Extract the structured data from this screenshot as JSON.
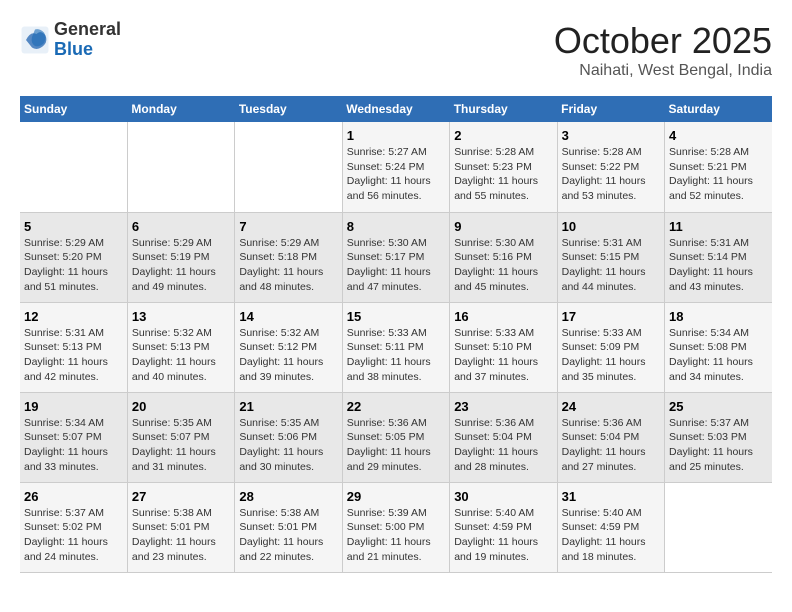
{
  "logo": {
    "general": "General",
    "blue": "Blue"
  },
  "title": "October 2025",
  "subtitle": "Naihati, West Bengal, India",
  "days_of_week": [
    "Sunday",
    "Monday",
    "Tuesday",
    "Wednesday",
    "Thursday",
    "Friday",
    "Saturday"
  ],
  "weeks": [
    [
      {
        "day": "",
        "sunrise": "",
        "sunset": "",
        "daylight": ""
      },
      {
        "day": "",
        "sunrise": "",
        "sunset": "",
        "daylight": ""
      },
      {
        "day": "",
        "sunrise": "",
        "sunset": "",
        "daylight": ""
      },
      {
        "day": "1",
        "sunrise": "Sunrise: 5:27 AM",
        "sunset": "Sunset: 5:24 PM",
        "daylight": "Daylight: 11 hours and 56 minutes."
      },
      {
        "day": "2",
        "sunrise": "Sunrise: 5:28 AM",
        "sunset": "Sunset: 5:23 PM",
        "daylight": "Daylight: 11 hours and 55 minutes."
      },
      {
        "day": "3",
        "sunrise": "Sunrise: 5:28 AM",
        "sunset": "Sunset: 5:22 PM",
        "daylight": "Daylight: 11 hours and 53 minutes."
      },
      {
        "day": "4",
        "sunrise": "Sunrise: 5:28 AM",
        "sunset": "Sunset: 5:21 PM",
        "daylight": "Daylight: 11 hours and 52 minutes."
      }
    ],
    [
      {
        "day": "5",
        "sunrise": "Sunrise: 5:29 AM",
        "sunset": "Sunset: 5:20 PM",
        "daylight": "Daylight: 11 hours and 51 minutes."
      },
      {
        "day": "6",
        "sunrise": "Sunrise: 5:29 AM",
        "sunset": "Sunset: 5:19 PM",
        "daylight": "Daylight: 11 hours and 49 minutes."
      },
      {
        "day": "7",
        "sunrise": "Sunrise: 5:29 AM",
        "sunset": "Sunset: 5:18 PM",
        "daylight": "Daylight: 11 hours and 48 minutes."
      },
      {
        "day": "8",
        "sunrise": "Sunrise: 5:30 AM",
        "sunset": "Sunset: 5:17 PM",
        "daylight": "Daylight: 11 hours and 47 minutes."
      },
      {
        "day": "9",
        "sunrise": "Sunrise: 5:30 AM",
        "sunset": "Sunset: 5:16 PM",
        "daylight": "Daylight: 11 hours and 45 minutes."
      },
      {
        "day": "10",
        "sunrise": "Sunrise: 5:31 AM",
        "sunset": "Sunset: 5:15 PM",
        "daylight": "Daylight: 11 hours and 44 minutes."
      },
      {
        "day": "11",
        "sunrise": "Sunrise: 5:31 AM",
        "sunset": "Sunset: 5:14 PM",
        "daylight": "Daylight: 11 hours and 43 minutes."
      }
    ],
    [
      {
        "day": "12",
        "sunrise": "Sunrise: 5:31 AM",
        "sunset": "Sunset: 5:13 PM",
        "daylight": "Daylight: 11 hours and 42 minutes."
      },
      {
        "day": "13",
        "sunrise": "Sunrise: 5:32 AM",
        "sunset": "Sunset: 5:13 PM",
        "daylight": "Daylight: 11 hours and 40 minutes."
      },
      {
        "day": "14",
        "sunrise": "Sunrise: 5:32 AM",
        "sunset": "Sunset: 5:12 PM",
        "daylight": "Daylight: 11 hours and 39 minutes."
      },
      {
        "day": "15",
        "sunrise": "Sunrise: 5:33 AM",
        "sunset": "Sunset: 5:11 PM",
        "daylight": "Daylight: 11 hours and 38 minutes."
      },
      {
        "day": "16",
        "sunrise": "Sunrise: 5:33 AM",
        "sunset": "Sunset: 5:10 PM",
        "daylight": "Daylight: 11 hours and 37 minutes."
      },
      {
        "day": "17",
        "sunrise": "Sunrise: 5:33 AM",
        "sunset": "Sunset: 5:09 PM",
        "daylight": "Daylight: 11 hours and 35 minutes."
      },
      {
        "day": "18",
        "sunrise": "Sunrise: 5:34 AM",
        "sunset": "Sunset: 5:08 PM",
        "daylight": "Daylight: 11 hours and 34 minutes."
      }
    ],
    [
      {
        "day": "19",
        "sunrise": "Sunrise: 5:34 AM",
        "sunset": "Sunset: 5:07 PM",
        "daylight": "Daylight: 11 hours and 33 minutes."
      },
      {
        "day": "20",
        "sunrise": "Sunrise: 5:35 AM",
        "sunset": "Sunset: 5:07 PM",
        "daylight": "Daylight: 11 hours and 31 minutes."
      },
      {
        "day": "21",
        "sunrise": "Sunrise: 5:35 AM",
        "sunset": "Sunset: 5:06 PM",
        "daylight": "Daylight: 11 hours and 30 minutes."
      },
      {
        "day": "22",
        "sunrise": "Sunrise: 5:36 AM",
        "sunset": "Sunset: 5:05 PM",
        "daylight": "Daylight: 11 hours and 29 minutes."
      },
      {
        "day": "23",
        "sunrise": "Sunrise: 5:36 AM",
        "sunset": "Sunset: 5:04 PM",
        "daylight": "Daylight: 11 hours and 28 minutes."
      },
      {
        "day": "24",
        "sunrise": "Sunrise: 5:36 AM",
        "sunset": "Sunset: 5:04 PM",
        "daylight": "Daylight: 11 hours and 27 minutes."
      },
      {
        "day": "25",
        "sunrise": "Sunrise: 5:37 AM",
        "sunset": "Sunset: 5:03 PM",
        "daylight": "Daylight: 11 hours and 25 minutes."
      }
    ],
    [
      {
        "day": "26",
        "sunrise": "Sunrise: 5:37 AM",
        "sunset": "Sunset: 5:02 PM",
        "daylight": "Daylight: 11 hours and 24 minutes."
      },
      {
        "day": "27",
        "sunrise": "Sunrise: 5:38 AM",
        "sunset": "Sunset: 5:01 PM",
        "daylight": "Daylight: 11 hours and 23 minutes."
      },
      {
        "day": "28",
        "sunrise": "Sunrise: 5:38 AM",
        "sunset": "Sunset: 5:01 PM",
        "daylight": "Daylight: 11 hours and 22 minutes."
      },
      {
        "day": "29",
        "sunrise": "Sunrise: 5:39 AM",
        "sunset": "Sunset: 5:00 PM",
        "daylight": "Daylight: 11 hours and 21 minutes."
      },
      {
        "day": "30",
        "sunrise": "Sunrise: 5:40 AM",
        "sunset": "Sunset: 4:59 PM",
        "daylight": "Daylight: 11 hours and 19 minutes."
      },
      {
        "day": "31",
        "sunrise": "Sunrise: 5:40 AM",
        "sunset": "Sunset: 4:59 PM",
        "daylight": "Daylight: 11 hours and 18 minutes."
      },
      {
        "day": "",
        "sunrise": "",
        "sunset": "",
        "daylight": ""
      }
    ]
  ]
}
